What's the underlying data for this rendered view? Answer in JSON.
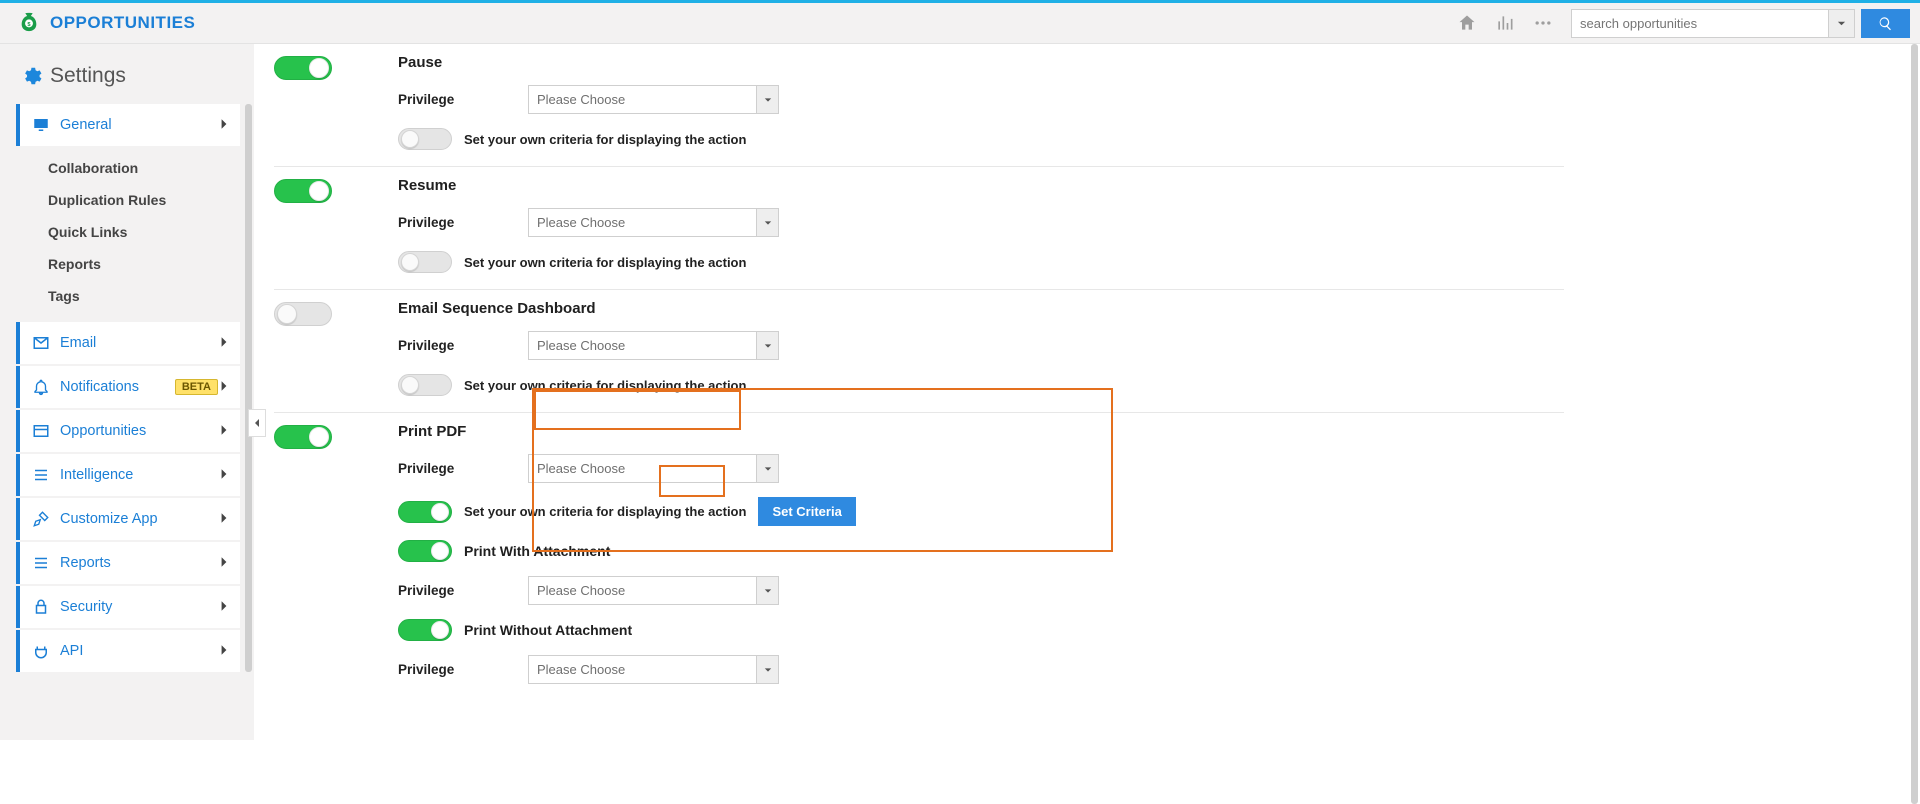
{
  "header": {
    "module_title": "OPPORTUNITIES",
    "search_placeholder": "search opportunities"
  },
  "sidebar": {
    "settings_label": "Settings",
    "sections": [
      {
        "icon": "monitor",
        "label": "General",
        "active": true
      },
      {
        "icon": "mail",
        "label": "Email"
      },
      {
        "icon": "bell",
        "label": "Notifications",
        "badge": "BETA"
      },
      {
        "icon": "grid",
        "label": "Opportunities"
      },
      {
        "icon": "list",
        "label": "Intelligence"
      },
      {
        "icon": "tools",
        "label": "Customize App"
      },
      {
        "icon": "list",
        "label": "Reports"
      },
      {
        "icon": "lock",
        "label": "Security"
      },
      {
        "icon": "plug",
        "label": "API"
      }
    ],
    "general_sub": [
      "Collaboration",
      "Duplication Rules",
      "Quick Links",
      "Reports",
      "Tags"
    ]
  },
  "labels": {
    "privilege": "Privilege",
    "please_choose": "Please Choose",
    "own_criteria": "Set your own criteria for displaying the action",
    "set_criteria": "Set Criteria"
  },
  "actions": [
    {
      "key": "pause",
      "title": "Pause",
      "main_toggle": true,
      "criteria_toggle": false
    },
    {
      "key": "resume",
      "title": "Resume",
      "main_toggle": true,
      "criteria_toggle": false
    },
    {
      "key": "esd",
      "title": "Email Sequence Dashboard",
      "main_toggle": false,
      "criteria_toggle": false
    },
    {
      "key": "printpdf",
      "title": "Print PDF",
      "main_toggle": true,
      "criteria_toggle": true,
      "show_set_criteria": true,
      "sub_actions": [
        {
          "title": "Print With Attachment",
          "toggle": true
        },
        {
          "title": "Print Without Attachment",
          "toggle": true
        }
      ]
    }
  ]
}
